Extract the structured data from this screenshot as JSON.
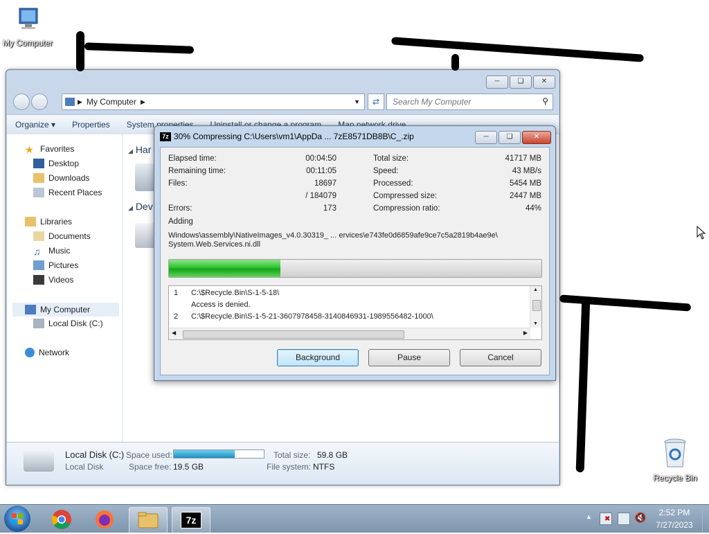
{
  "desktop": {
    "icons": [
      {
        "label": "My Computer"
      },
      {
        "label": "Recycle Bin"
      }
    ]
  },
  "explorer": {
    "address": "My Computer",
    "search_placeholder": "Search My Computer",
    "commands": [
      "Organize",
      "Properties",
      "System properties",
      "Uninstall or change a program",
      "Map network drive"
    ],
    "nav": {
      "favorites": "Favorites",
      "desktop": "Desktop",
      "downloads": "Downloads",
      "recent": "Recent Places",
      "libraries": "Libraries",
      "documents": "Documents",
      "music": "Music",
      "pictures": "Pictures",
      "videos": "Videos",
      "computer": "My Computer",
      "local_disk": "Local Disk (C:)",
      "network": "Network"
    },
    "groups": [
      "Har",
      "Dev"
    ],
    "details": {
      "name": "Local Disk (C:)",
      "type": "Local Disk",
      "space_used_label": "Space used:",
      "space_used_fraction": 0.68,
      "space_free_label": "Space free:",
      "space_free": "19.5 GB",
      "total_size_label": "Total size:",
      "total_size": "59.8 GB",
      "fs_label": "File system:",
      "fs": "NTFS"
    }
  },
  "zip": {
    "title": "30% Compressing C:\\Users\\vm1\\AppDa ... 7zE8571DB8B\\C_.zip",
    "stats_left": [
      {
        "label": "Elapsed time:",
        "value": "00:04:50"
      },
      {
        "label": "Remaining time:",
        "value": "00:11:05"
      },
      {
        "label": "Files:",
        "value": "18697"
      },
      {
        "label": "",
        "value": "/ 184079"
      },
      {
        "label": "Errors:",
        "value": "173"
      }
    ],
    "stats_right": [
      {
        "label": "Total size:",
        "value": "41717 MB"
      },
      {
        "label": "Speed:",
        "value": "43 MB/s"
      },
      {
        "label": "Processed:",
        "value": "5454 MB"
      },
      {
        "label": "Compressed size:",
        "value": "2447 MB"
      },
      {
        "label": "Compression ratio:",
        "value": "44%"
      }
    ],
    "adding_label": "Adding",
    "current_path_1": "Windows\\assembly\\NativeImages_v4.0.30319_ ... ervices\\e743fe0d6859afe9ce7c5a2819b4ae9e\\",
    "current_path_2": "System.Web.Services.ni.dll",
    "progress": 0.3,
    "log": [
      {
        "num": "1",
        "text": "C:\\$Recycle.Bin\\S-1-5-18\\"
      },
      {
        "num": "",
        "text": "Access is denied."
      },
      {
        "num": "2",
        "text": "C:\\$Recycle.Bin\\S-1-5-21-3607978458-3140846931-1989556482-1000\\"
      }
    ],
    "buttons": {
      "background": "Background",
      "pause": "Pause",
      "cancel": "Cancel"
    }
  },
  "taskbar": {
    "time": "2:52 PM",
    "date": "7/27/2023"
  }
}
